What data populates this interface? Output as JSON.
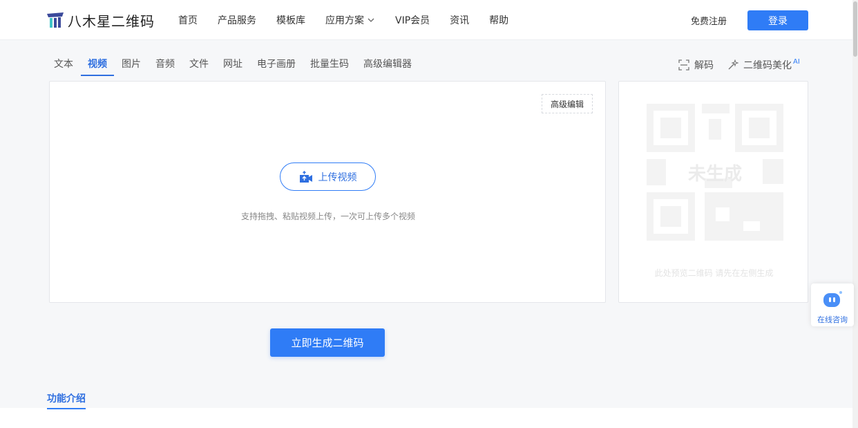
{
  "brand": {
    "name": "八木星二维码",
    "colors": {
      "primary": "#2f7cf6",
      "logo_dark": "#3b4a9b",
      "logo_accent": "#40c4c8"
    }
  },
  "header": {
    "nav": [
      {
        "label": "首页"
      },
      {
        "label": "产品服务"
      },
      {
        "label": "模板库"
      },
      {
        "label": "应用方案",
        "has_dropdown": true
      },
      {
        "label": "VIP会员"
      },
      {
        "label": "资讯"
      },
      {
        "label": "帮助"
      }
    ],
    "register": "免费注册",
    "login": "登录"
  },
  "tabs": {
    "items": [
      "文本",
      "视频",
      "图片",
      "音频",
      "文件",
      "网址",
      "电子画册",
      "批量生码",
      "高级编辑器"
    ],
    "active": "视频"
  },
  "tools": {
    "decode": "解码",
    "beautify": "二维码美化",
    "beautify_badge": "AI"
  },
  "editor": {
    "advanced_edit": "高级编辑",
    "upload_button": "上传视频",
    "upload_hint": "支持拖拽、粘贴视频上传，一次可上传多个视频"
  },
  "preview": {
    "watermark": "未生成",
    "caption": "此处预览二维码 请先在左侧生成"
  },
  "side_service": {
    "label": "在线咨询"
  },
  "generate_button": "立即生成二维码",
  "feature_section": {
    "title": "功能介绍"
  }
}
